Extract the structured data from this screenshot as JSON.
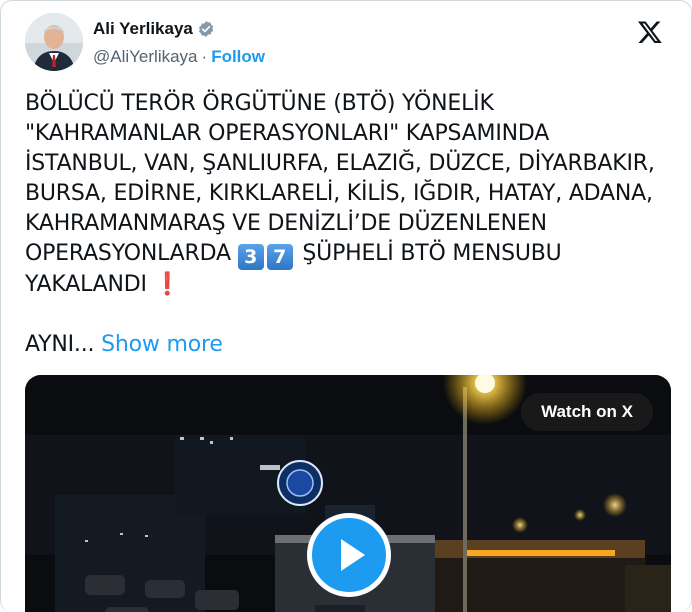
{
  "author": {
    "name": "Ali Yerlikaya",
    "handle": "@AliYerlikaya",
    "separator": "·",
    "follow_label": "Follow"
  },
  "icons": {
    "verified": "verified-badge-icon",
    "logo": "x-logo-icon",
    "play": "play-icon"
  },
  "colors": {
    "accent": "#1d9bf0",
    "text": "#0f1419",
    "secondary": "#536471",
    "keycap": "#4a90d9",
    "exclamation": "#d81e2c"
  },
  "tweet": {
    "lines": [
      "BÖLÜCÜ TERÖR ÖRGÜTÜNE (BTÖ) YÖNELİK",
      "\"KAHRAMANLAR OPERASYONLARI\" KAPSAMINDA",
      "İSTANBUL, VAN, ŞANLIURFA, ELAZIĞ, DÜZCE, DİYARBAKIR,",
      "BURSA, EDİRNE, KIRKLARELİ, KİLİS, IĞDIR, HATAY, ADANA,",
      "KAHRAMANMARAŞ VE DENİZLİ’DE DÜZENLENEN"
    ],
    "line6_prefix": "OPERASYONLARDA",
    "digit_1": "3",
    "digit_2": "7",
    "line6_suffix": "ŞÜPHELİ BTÖ MENSUBU",
    "line7": "YAKALANDI",
    "exclamation": "❗",
    "truncated": "AYNI...",
    "show_more": "Show more"
  },
  "media": {
    "watch_label": "Watch on X"
  }
}
